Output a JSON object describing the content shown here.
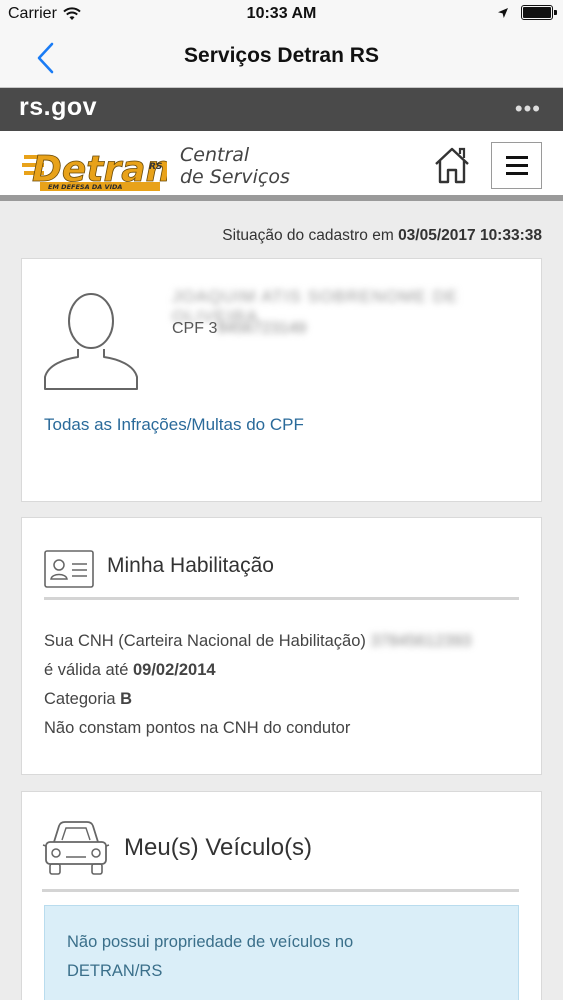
{
  "statusbar": {
    "carrier": "Carrier",
    "time": "10:33 AM",
    "battery_level": 1.0
  },
  "navbar": {
    "title": "Serviços Detran RS"
  },
  "govbar": {
    "logo": "rs.gov",
    "more": "•••"
  },
  "brand": {
    "logo_text": "Detran",
    "logo_superscript": "RS",
    "logo_tagline": "EM DEFESA DA VIDA",
    "central_line1": "Central",
    "central_line2": "de Serviços"
  },
  "situacao": {
    "label": "Situação do cadastro em",
    "datetime": "03/05/2017 10:33:38"
  },
  "profile": {
    "name_blurred": "JOAQUIM ATIS SOBRENOME DE OLIVEIRA",
    "cpf_label": "CPF 3",
    "cpf_blurred": "8456723149",
    "infracoes_link": "Todas as Infrações/Multas do CPF"
  },
  "cnh": {
    "title": "Minha Habilitação",
    "line1_prefix": "Sua CNH (Carteira Nacional de Habilitação)",
    "line1_blurred": "37845612393",
    "line2_prefix": "é válida até",
    "line2_date": "09/02/2014",
    "line3_prefix": "Categoria",
    "line3_category": "B",
    "line4": "Não constam pontos na CNH do condutor"
  },
  "vehicle": {
    "title": "Meu(s) Veículo(s)",
    "info_line1": "Não possui propriedade de veículos no",
    "info_line2": "DETRAN/RS"
  },
  "colors": {
    "accent_link": "#2a6a9a",
    "ios_blue": "#1a7cf5",
    "gov_bar": "#4a4a4a",
    "detran_orange": "#e8a21a",
    "info_bg": "#daeef8"
  }
}
